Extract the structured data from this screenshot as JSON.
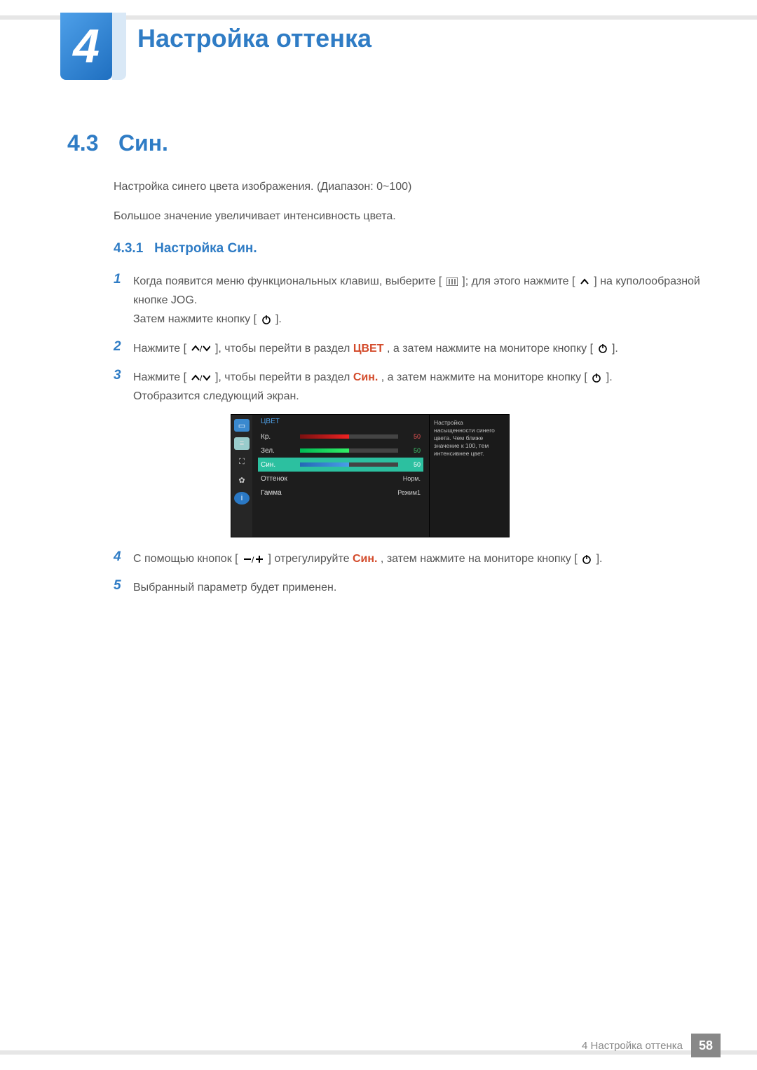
{
  "chapter": {
    "number": "4",
    "title": "Настройка оттенка"
  },
  "section": {
    "number": "4.3",
    "title": "Син."
  },
  "intro": {
    "p1": "Настройка синего цвета изображения. (Диапазон: 0~100)",
    "p2": "Большое значение увеличивает интенсивность цвета."
  },
  "subsection": {
    "number": "4.3.1",
    "title": "Настройка Син."
  },
  "steps": {
    "s1": {
      "num": "1",
      "a": "Когда появится меню функциональных клавиш, выберите [",
      "b": "]; для этого нажмите [",
      "c": "] на куполообразной кнопке JOG.",
      "d": "Затем нажмите кнопку [",
      "e": "]."
    },
    "s2": {
      "num": "2",
      "a": "Нажмите [",
      "b": "], чтобы перейти в раздел ",
      "cword": "ЦВЕТ",
      "c": ", а затем нажмите на мониторе кнопку [",
      "d": "]."
    },
    "s3": {
      "num": "3",
      "a": "Нажмите [",
      "b": "], чтобы перейти в раздел ",
      "cword": "Син.",
      "c": ", а затем нажмите на мониторе кнопку [",
      "d": "].",
      "e": "Отобразится следующий экран."
    },
    "s4": {
      "num": "4",
      "a": "С помощью кнопок [",
      "b": "] отрегулируйте ",
      "cword": "Син.",
      "c": ", затем нажмите на мониторе кнопку [",
      "d": "]."
    },
    "s5": {
      "num": "5",
      "a": "Выбранный параметр будет применен."
    }
  },
  "osd": {
    "title": "ЦВЕТ",
    "rows": {
      "r": {
        "label": "Кр.",
        "val": "50"
      },
      "g": {
        "label": "Зел.",
        "val": "50"
      },
      "b": {
        "label": "Син.",
        "val": "50"
      },
      "hue": {
        "label": "Оттенок",
        "val": "Норм."
      },
      "gamma": {
        "label": "Гамма",
        "val": "Режим1"
      }
    },
    "info": "Настройка насыщенности синего цвета. Чем ближе значение к 100, тем интенсивнее цвет."
  },
  "footer": {
    "text": "4 Настройка оттенка",
    "page": "58"
  }
}
